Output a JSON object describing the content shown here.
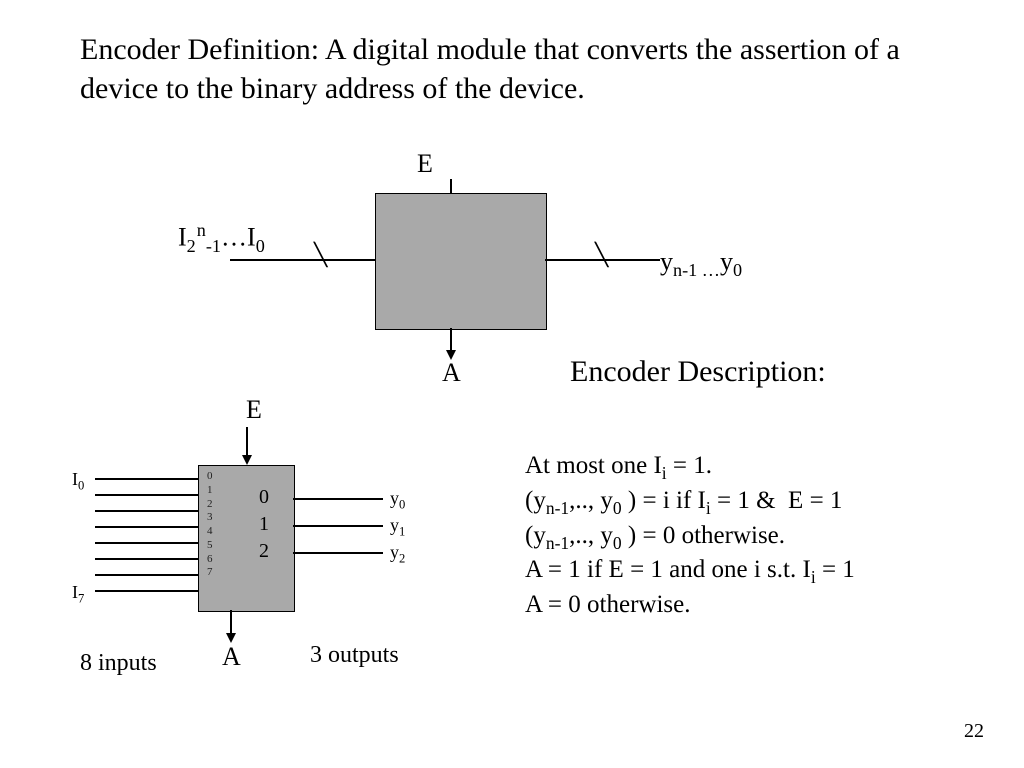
{
  "title": "Encoder Definition: A digital module that converts the assertion of a device to the binary address of the device.",
  "diagram_top": {
    "e_label": "E",
    "a_label": "A",
    "input_html": "I<span class='sub'>2</span><span class='sup' style='margin-left:1px;'>n</span><span class='sub'>-1</span>…I<span class='sub'>0</span>",
    "output_html": "y<span class='sub'>n-1 …</span>y<span class='sub'>0</span>"
  },
  "diagram_bottom": {
    "e_label": "E",
    "a_label": "A",
    "i0": "I<span class='sub'>0</span>",
    "i7": "I<span class='sub'>7</span>",
    "y0": "y<span class='sub'>0</span>",
    "y1": "y<span class='sub'>1</span>",
    "y2": "y<span class='sub'>2</span>",
    "in_idx": "0\n1\n2\n3\n4\n5\n6\n7",
    "out_idx": "0\n1\n2",
    "inputs_note": "8 inputs",
    "outputs_note": "3 outputs"
  },
  "description": {
    "heading": "Encoder Description:",
    "line1": "At most one I<span class='sub'>i</span> = 1.",
    "line2": "(y<span class='sub'>n-1</span>,.., y<span class='sub'>0</span> ) = i if I<span class='sub'>i</span> = 1 &amp;&nbsp; E = 1",
    "line3": "(y<span class='sub'>n-1</span>,.., y<span class='sub'>0</span> ) = 0 otherwise.",
    "line4": "A = 1 if E = 1 and one i s.t. I<span class='sub'>i</span> = 1",
    "line5": "A = 0 otherwise."
  },
  "page_number": "22"
}
